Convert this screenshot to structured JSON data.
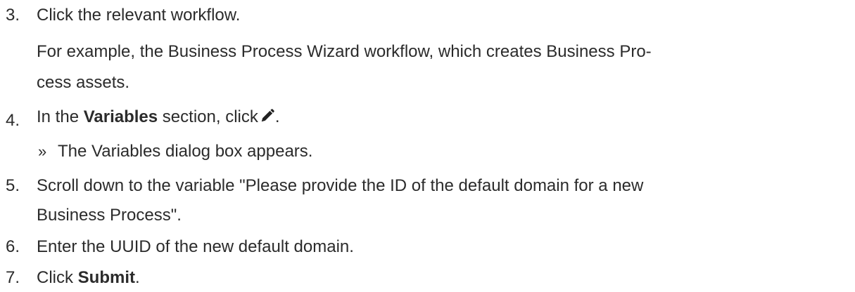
{
  "steps": {
    "s3": {
      "number": "3.",
      "text": "Click the relevant workflow.",
      "note_line1": "For example, the Business Process Wizard workflow, which creates Business Pro-",
      "note_line2": "cess assets."
    },
    "s4": {
      "number": "4.",
      "before": "In the ",
      "strong": "Variables",
      "after": " section, click",
      "icon": "pencil-icon",
      "end": ".",
      "result_marker": "»",
      "result_text": "The Variables dialog box appears."
    },
    "s5": {
      "number": "5.",
      "line1": "Scroll down to the variable \"Please provide the ID of the default domain for a new",
      "line2": "Business Process\"."
    },
    "s6": {
      "number": "6.",
      "text": "Enter the UUID of the new default domain."
    },
    "s7": {
      "number": "7.",
      "before": "Click ",
      "strong": "Submit",
      "end": "."
    }
  }
}
